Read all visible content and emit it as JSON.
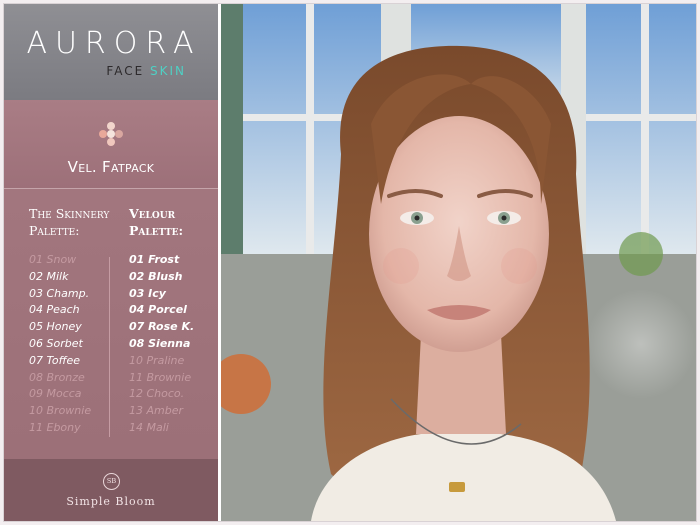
{
  "brand": {
    "title": "AURORA",
    "subtitle_part1": "FACE",
    "subtitle_part2": "SKIN"
  },
  "pack": {
    "title": "Vel. Fatpack"
  },
  "skinnery": {
    "heading_line1": "The Skinnery",
    "heading_line2": "Palette:",
    "items": [
      {
        "label": "01 Snow",
        "dim": true
      },
      {
        "label": "02 Milk",
        "dim": false
      },
      {
        "label": "03 Champ.",
        "dim": false
      },
      {
        "label": "04 Peach",
        "dim": false
      },
      {
        "label": "05 Honey",
        "dim": false
      },
      {
        "label": "06 Sorbet",
        "dim": false
      },
      {
        "label": "07 Toffee",
        "dim": false
      },
      {
        "label": "08 Bronze",
        "dim": true
      },
      {
        "label": "09 Mocca",
        "dim": true
      },
      {
        "label": "10 Brownie",
        "dim": true
      },
      {
        "label": "11 Ebony",
        "dim": true
      }
    ]
  },
  "velour": {
    "heading_line1": "Velour",
    "heading_line2": "Palette:",
    "items": [
      {
        "label": "01 Frost",
        "dim": false
      },
      {
        "label": "02 Blush",
        "dim": false
      },
      {
        "label": "03 Icy",
        "dim": false
      },
      {
        "label": "04 Porcel",
        "dim": false
      },
      {
        "label": "07 Rose K.",
        "dim": false
      },
      {
        "label": "08 Sienna",
        "dim": false
      },
      {
        "label": "10 Praline",
        "dim": true
      },
      {
        "label": "11 Brownie",
        "dim": true
      },
      {
        "label": "12 Choco.",
        "dim": true
      },
      {
        "label": "13 Amber",
        "dim": true
      },
      {
        "label": "14 Mali",
        "dim": true
      }
    ]
  },
  "footer": {
    "logo_mark": "SB",
    "brand_name": "Simple Bloom"
  },
  "colors": {
    "accent_teal": "#4fd0c4",
    "panel_rose": "#a2767e",
    "header_gray": "#8a8a8f",
    "footer_rose": "#7f5a61",
    "dot_colors": [
      "#f2d5cc",
      "#e8a89a",
      "#f5e4dd",
      "#d9a7a0",
      "#f0c7bd"
    ]
  }
}
